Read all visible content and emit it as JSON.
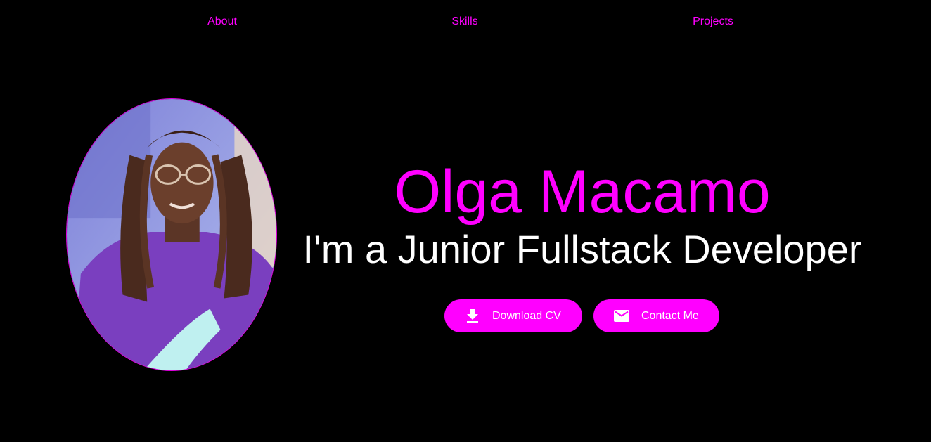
{
  "nav": {
    "items": [
      {
        "label": "About"
      },
      {
        "label": "Skills"
      },
      {
        "label": "Projects"
      }
    ]
  },
  "hero": {
    "name": "Olga Macamo",
    "role": "I'm a Junior Fullstack Developer"
  },
  "buttons": {
    "download_cv": {
      "label": "Download CV",
      "icon": "download-icon"
    },
    "contact": {
      "label": "Contact Me",
      "icon": "mail-icon"
    }
  },
  "colors": {
    "accent": "#ff00ff",
    "background": "#000000",
    "text": "#ffffff"
  }
}
